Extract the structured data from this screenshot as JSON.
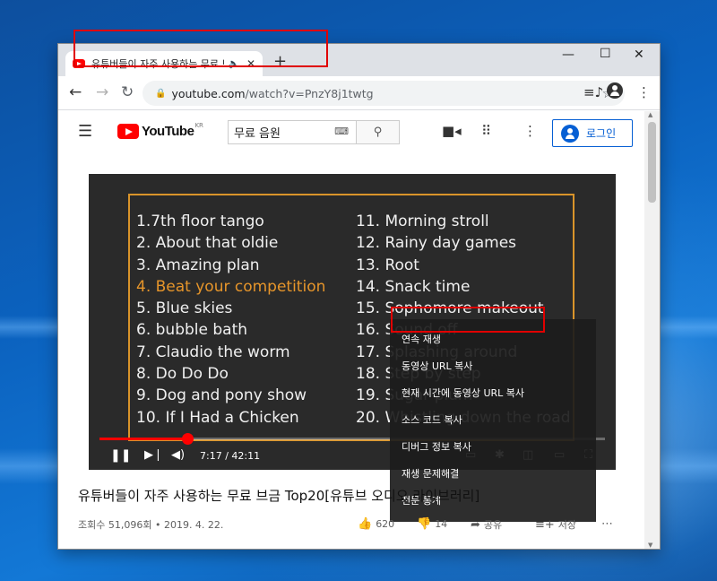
{
  "browser": {
    "tab_title": "유튜버들이 자주 사용하는 무료 브금",
    "tab_audio_icon": "speaker-icon",
    "tab_close": "✕",
    "new_tab": "+",
    "url_host": "youtube.com",
    "url_path": "/watch?v=PnzY8j1twtg"
  },
  "youtube": {
    "logo_text": "YouTube",
    "region": "KR",
    "search_value": "무료 음원",
    "login_label": "로그인"
  },
  "video": {
    "left_tracks": [
      "1.7th floor tango",
      "2. About that oldie",
      "3. Amazing plan",
      "4. Beat your competition",
      "5. Blue skies",
      "6. bubble bath",
      "7. Claudio the worm",
      "8. Do Do Do",
      "9. Dog and pony show",
      "10. If I Had a Chicken"
    ],
    "right_tracks": [
      "11. Morning stroll",
      "12. Rainy day games",
      "13. Root",
      "14. Snack time",
      "15. Sophomore makeout",
      "16. Sound off",
      "17. Splashing around",
      "18. Step by step",
      "19. Sugar plum",
      "20. Whistling down the road"
    ],
    "active_track_index": 3,
    "time": "7:17 / 42:11",
    "progress_fraction": 0.173
  },
  "context_menu": {
    "items": [
      "연속 재생",
      "동영상 URL 복사",
      "현재 시간에 동영상 URL 복사",
      "소스 코드 복사",
      "디버그 정보 복사",
      "재생 문제해결",
      "전문 통계"
    ]
  },
  "info": {
    "title": "유튜버들이 자주 사용하는 무료 브금 Top20[유튜브 오디오 라이브러리]",
    "views_date": "조회수 51,096회 • 2019. 4. 22.",
    "likes": "620",
    "dislikes": "14",
    "share": "공유",
    "save": "저장"
  },
  "colors": {
    "accent_blue": "#065fd4",
    "youtube_red": "#ff0000",
    "track_active": "#e6952a",
    "highlight_box": "#e00000"
  }
}
